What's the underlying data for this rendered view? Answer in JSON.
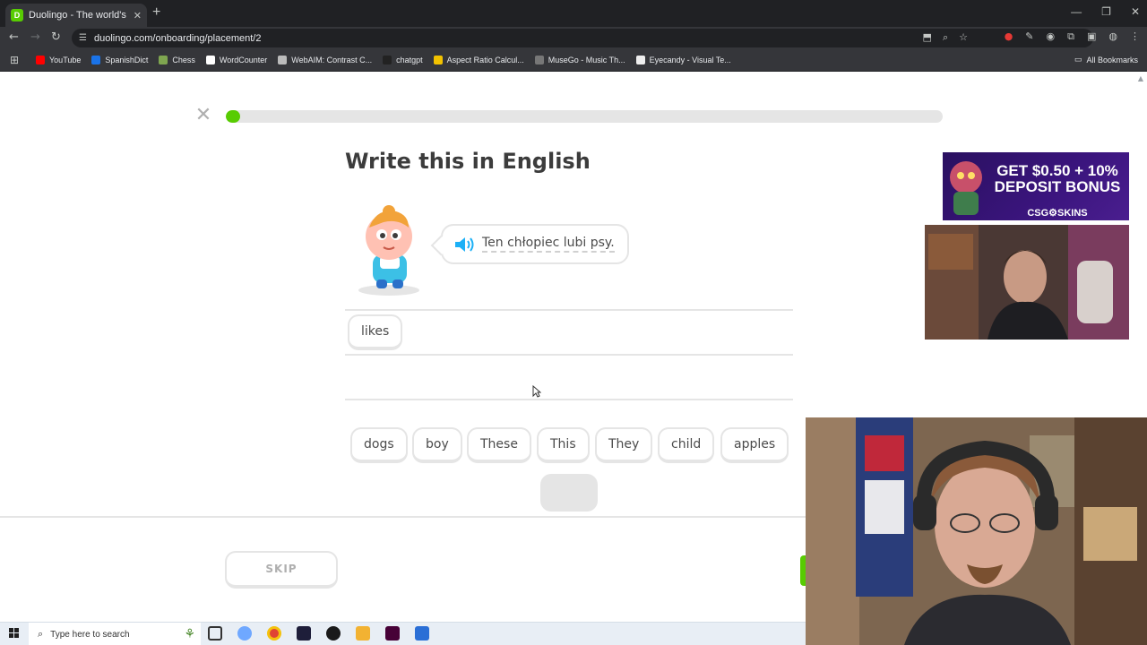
{
  "browser": {
    "tab_title": "Duolingo - The world's best wa",
    "tab_favicon": "duo",
    "url": "duolingo.com/onboarding/placement/2",
    "bookmarks": [
      {
        "label": "YouTube",
        "color": "#ff0000"
      },
      {
        "label": "SpanishDict",
        "color": "#1a73e8"
      },
      {
        "label": "Chess",
        "color": "#7fa650"
      },
      {
        "label": "WordCounter",
        "color": "#ffffff"
      },
      {
        "label": "WebAIM: Contrast C...",
        "color": "#bbbbbb"
      },
      {
        "label": "chatgpt",
        "color": "#222222"
      },
      {
        "label": "Aspect Ratio Calcul...",
        "color": "#f2c200"
      },
      {
        "label": "MuseGo - Music Th...",
        "color": "#777777"
      },
      {
        "label": "Eyecandy - Visual Te...",
        "color": "#eeeeee"
      }
    ],
    "bookmark_icon_letters": [
      "",
      "",
      "",
      "W",
      "",
      "",
      "",
      "",
      ""
    ],
    "all_bookmarks": "All Bookmarks"
  },
  "lesson": {
    "progress": 0.02,
    "title": "Write this in English",
    "prompt": "Ten chłopiec lubi psy.",
    "answer_tokens": [
      "likes"
    ],
    "word_bank": [
      "dogs",
      "boy",
      "These",
      "This",
      "They",
      "child",
      "apples"
    ],
    "skip_label": "SKIP",
    "colors": {
      "accent": "#58cc02",
      "border": "#e5e5e5",
      "text": "#4b4b4b",
      "speaker": "#1cb0f6"
    }
  },
  "ad": {
    "headline": "GET $0.50 + 10% DEPOSIT BONUS",
    "brand": "CSG⚙SKINS"
  },
  "taskbar": {
    "search_placeholder": "Type here to search"
  }
}
